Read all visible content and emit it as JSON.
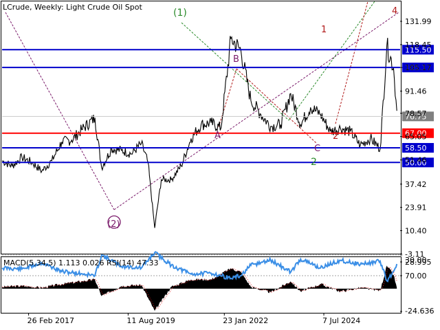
{
  "header": {
    "symbol_text": "LCrude, Weekly:  Light Crude Oil Spot"
  },
  "price_axis": {
    "ticks": [
      "131.99",
      "118.45",
      "105.17",
      "91.46",
      "78.57",
      "65.05",
      "51.46",
      "37.42",
      "23.91",
      "10.40",
      "-3.11"
    ]
  },
  "time_axis": {
    "labels": [
      "26 Feb 2017",
      "11 Aug 2019",
      "23 Jan 2022",
      "7 Jul 2024"
    ]
  },
  "indicator": {
    "label_text": "MACD(5,34,5) 1.113 0.026 RSI(14) 47.33",
    "ticks": [
      "28.995",
      "70.00",
      "30.00",
      "-24.636"
    ]
  },
  "colors": {
    "price": "#000000",
    "support_resistance": "#0000cc",
    "key_level": "#ff0000",
    "wave_major": "#7a1a6a",
    "wave_green": "#2a8a2a",
    "wave_red": "#b01818",
    "rsi_line": "#3a8ee6",
    "current_price_tag": "#808080"
  },
  "chart_data": [
    {
      "type": "line",
      "title": "LCrude, Weekly:  Light Crude Oil Spot",
      "xlabel": "",
      "ylabel": "",
      "ylim": [
        -3.11,
        131.99
      ],
      "x_tick_labels": [
        "26 Feb 2017",
        "11 Aug 2019",
        "23 Jan 2022",
        "7 Jul 2024"
      ],
      "series": [
        {
          "x": [
            "2016-06",
            "2016-09",
            "2016-12",
            "2017-03",
            "2017-06",
            "2017-09",
            "2017-12",
            "2018-03",
            "2018-06",
            "2018-10",
            "2018-12",
            "2019-03",
            "2019-06",
            "2019-09",
            "2019-12",
            "2020-02",
            "2020-04",
            "2020-06",
            "2020-09",
            "2020-12",
            "2021-03",
            "2021-06",
            "2021-09",
            "2021-12",
            "2022-03",
            "2022-06",
            "2022-09",
            "2022-12",
            "2023-03",
            "2023-06",
            "2023-09",
            "2023-12",
            "2024-03",
            "2024-06",
            "2024-09",
            "2024-12",
            "2025-03",
            "2025-06",
            "2025-09",
            "2025-12",
            "2026-02",
            "2026-04",
            "2026-05"
          ],
          "values": [
            51,
            48,
            53,
            50,
            45,
            51,
            62,
            63,
            69,
            76,
            47,
            58,
            57,
            55,
            61,
            50,
            12,
            40,
            40,
            48,
            64,
            72,
            73,
            70,
            122,
            115,
            86,
            78,
            71,
            72,
            90,
            72,
            82,
            78,
            68,
            70,
            68,
            60,
            64,
            58,
            118,
            105,
            80
          ]
        }
      ],
      "horizontal_levels": [
        {
          "value": 115.5,
          "label": "115.50"
        },
        {
          "value": 105.17,
          "label": "105.17"
        },
        {
          "value": 67.0,
          "label": "67.00"
        },
        {
          "value": 58.5,
          "label": "58.50"
        },
        {
          "value": 50.0,
          "label": "50.00"
        }
      ],
      "current_price": {
        "value": 76.75,
        "label": "76.75"
      },
      "wave_labels": [
        "(1)",
        "(2)",
        "1",
        "2",
        "4",
        "A",
        "B",
        "C",
        "2"
      ]
    },
    {
      "type": "area",
      "title": "MACD(5,34,5) 1.113 0.026 RSI(14) 47.33",
      "ylim": [
        -24.636,
        28.995
      ],
      "tick_labels": [
        "28.995",
        "70.00",
        "30.00",
        "-24.636"
      ],
      "series": [
        {
          "name": "MACD(5,34,5)",
          "x": [
            "2016-06",
            "2016-12",
            "2017-06",
            "2017-12",
            "2018-06",
            "2018-10",
            "2018-12",
            "2019-06",
            "2019-12",
            "2020-04",
            "2020-09",
            "2021-03",
            "2021-09",
            "2022-03",
            "2022-06",
            "2022-09",
            "2023-03",
            "2023-09",
            "2023-12",
            "2024-06",
            "2024-12",
            "2025-06",
            "2025-12",
            "2026-02",
            "2026-04",
            "2026-05"
          ],
          "values": [
            2,
            3,
            1,
            5,
            8,
            10,
            -8,
            3,
            4,
            -24,
            2,
            10,
            10,
            22,
            18,
            2,
            -4,
            8,
            -3,
            5,
            -3,
            1,
            -2,
            25,
            15,
            1.113
          ]
        },
        {
          "name": "RSI(14)",
          "x": [
            "2016-06",
            "2016-12",
            "2017-06",
            "2017-12",
            "2018-06",
            "2018-10",
            "2018-12",
            "2019-06",
            "2019-12",
            "2020-04",
            "2020-09",
            "2021-03",
            "2021-09",
            "2022-03",
            "2022-06",
            "2022-09",
            "2023-03",
            "2023-09",
            "2023-12",
            "2024-06",
            "2024-12",
            "2025-06",
            "2025-12",
            "2026-02",
            "2026-04",
            "2026-05"
          ],
          "values": [
            55,
            57,
            45,
            62,
            66,
            70,
            30,
            52,
            55,
            25,
            50,
            67,
            65,
            75,
            70,
            50,
            40,
            63,
            38,
            55,
            40,
            48,
            42,
            80,
            62,
            47.33
          ]
        }
      ]
    }
  ]
}
